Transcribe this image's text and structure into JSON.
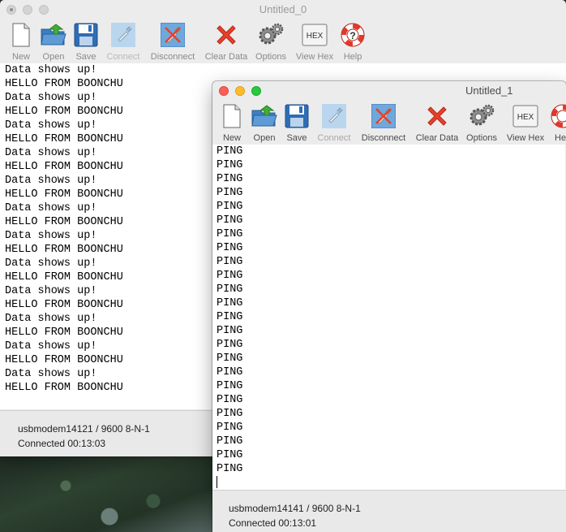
{
  "windows": [
    {
      "title": "Untitled_0",
      "toolbar": {
        "new": "New",
        "open": "Open",
        "save": "Save",
        "connect": "Connect",
        "disconnect": "Disconnect",
        "clear": "Clear Data",
        "options": "Options",
        "viewhex": "View Hex",
        "help": "Help",
        "hex_glyph": "HEX"
      },
      "lines": [
        "Data shows up!",
        "HELLO FROM BOONCHU",
        "Data shows up!",
        "HELLO FROM BOONCHU",
        "Data shows up!",
        "HELLO FROM BOONCHU",
        "Data shows up!",
        "HELLO FROM BOONCHU",
        "Data shows up!",
        "HELLO FROM BOONCHU",
        "Data shows up!",
        "HELLO FROM BOONCHU",
        "Data shows up!",
        "HELLO FROM BOONCHU",
        "Data shows up!",
        "HELLO FROM BOONCHU",
        "Data shows up!",
        "HELLO FROM BOONCHU",
        "Data shows up!",
        "HELLO FROM BOONCHU",
        "Data shows up!",
        "HELLO FROM BOONCHU",
        "Data shows up!",
        "HELLO FROM BOONCHU"
      ],
      "status": {
        "port": "usbmodem14121 / 9600 8-N-1",
        "connection": "Connected 00:13:03"
      }
    },
    {
      "title": "Untitled_1",
      "toolbar": {
        "new": "New",
        "open": "Open",
        "save": "Save",
        "connect": "Connect",
        "disconnect": "Disconnect",
        "clear": "Clear Data",
        "options": "Options",
        "viewhex": "View Hex",
        "help": "He",
        "hex_glyph": "HEX"
      },
      "lines": [
        "PING",
        "PING",
        "PING",
        "PING",
        "PING",
        "PING",
        "PING",
        "PING",
        "PING",
        "PING",
        "PING",
        "PING",
        "PING",
        "PING",
        "PING",
        "PING",
        "PING",
        "PING",
        "PING",
        "PING",
        "PING",
        "PING",
        "PING",
        "PING"
      ],
      "status": {
        "port": "usbmodem14141 / 9600 8-N-1",
        "connection": "Connected 00:13:01"
      }
    }
  ],
  "icons": {
    "new": "document-icon",
    "open": "folder-open-icon",
    "save": "floppy-disk-icon",
    "connect": "plug-icon",
    "disconnect": "disconnect-plug-icon",
    "clear": "red-x-icon",
    "options": "gears-icon",
    "viewhex": "hex-icon",
    "help": "lifebuoy-icon"
  },
  "colors": {
    "clear_red": "#e8402a",
    "help_red": "#e03a2a",
    "open_green": "#3fae3a",
    "save_blue": "#2f6db5"
  }
}
